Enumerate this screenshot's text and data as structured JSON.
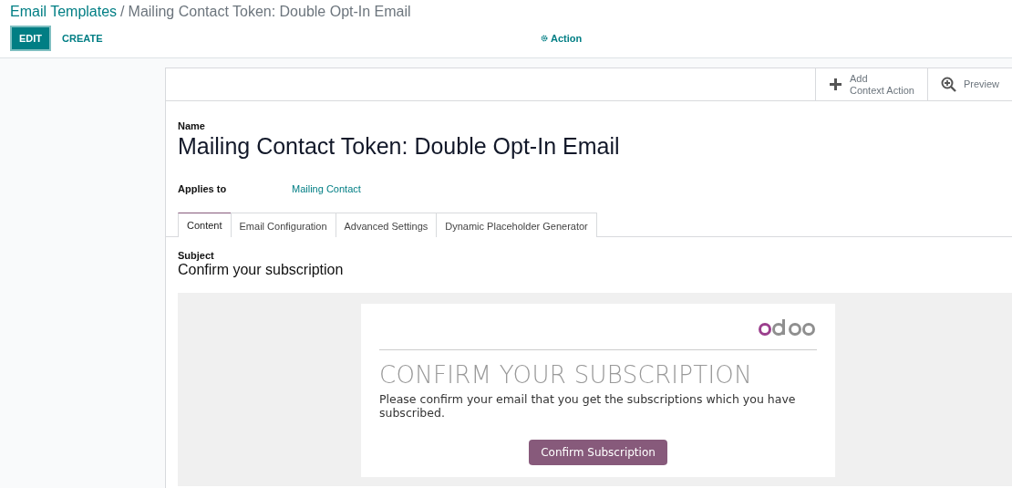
{
  "breadcrumb": {
    "parent": "Email Templates",
    "separator": "/",
    "current": "Mailing Contact Token: Double Opt-In Email"
  },
  "buttons": [
    {
      "label": "EDIT",
      "kind": "primary"
    },
    {
      "label": "CREATE",
      "kind": "link"
    }
  ],
  "action_menu": {
    "label": "Action"
  },
  "sheet_buttons": [
    {
      "kind": "add",
      "label": "Add\nContext Action"
    },
    {
      "kind": "preview",
      "label": "Preview"
    }
  ],
  "name": {
    "label": "Name",
    "value": "Mailing Contact Token: Double Opt-In Email"
  },
  "applies_to": {
    "label": "Applies to",
    "value": "Mailing Contact"
  },
  "tabs": [
    {
      "label": "Content",
      "selected": true
    },
    {
      "label": "Email Configuration",
      "selected": false
    },
    {
      "label": "Advanced Settings",
      "selected": false
    },
    {
      "label": "Dynamic Placeholder Generator",
      "selected": false
    }
  ],
  "subject": {
    "label": "Subject",
    "value": "Confirm your subscription"
  },
  "email_body": {
    "heading": "CONFIRM YOUR SUBSCRIPTION",
    "text": "Please confirm your email that you get the subscriptions which you have subscribed.",
    "button": "Confirm Subscription"
  }
}
